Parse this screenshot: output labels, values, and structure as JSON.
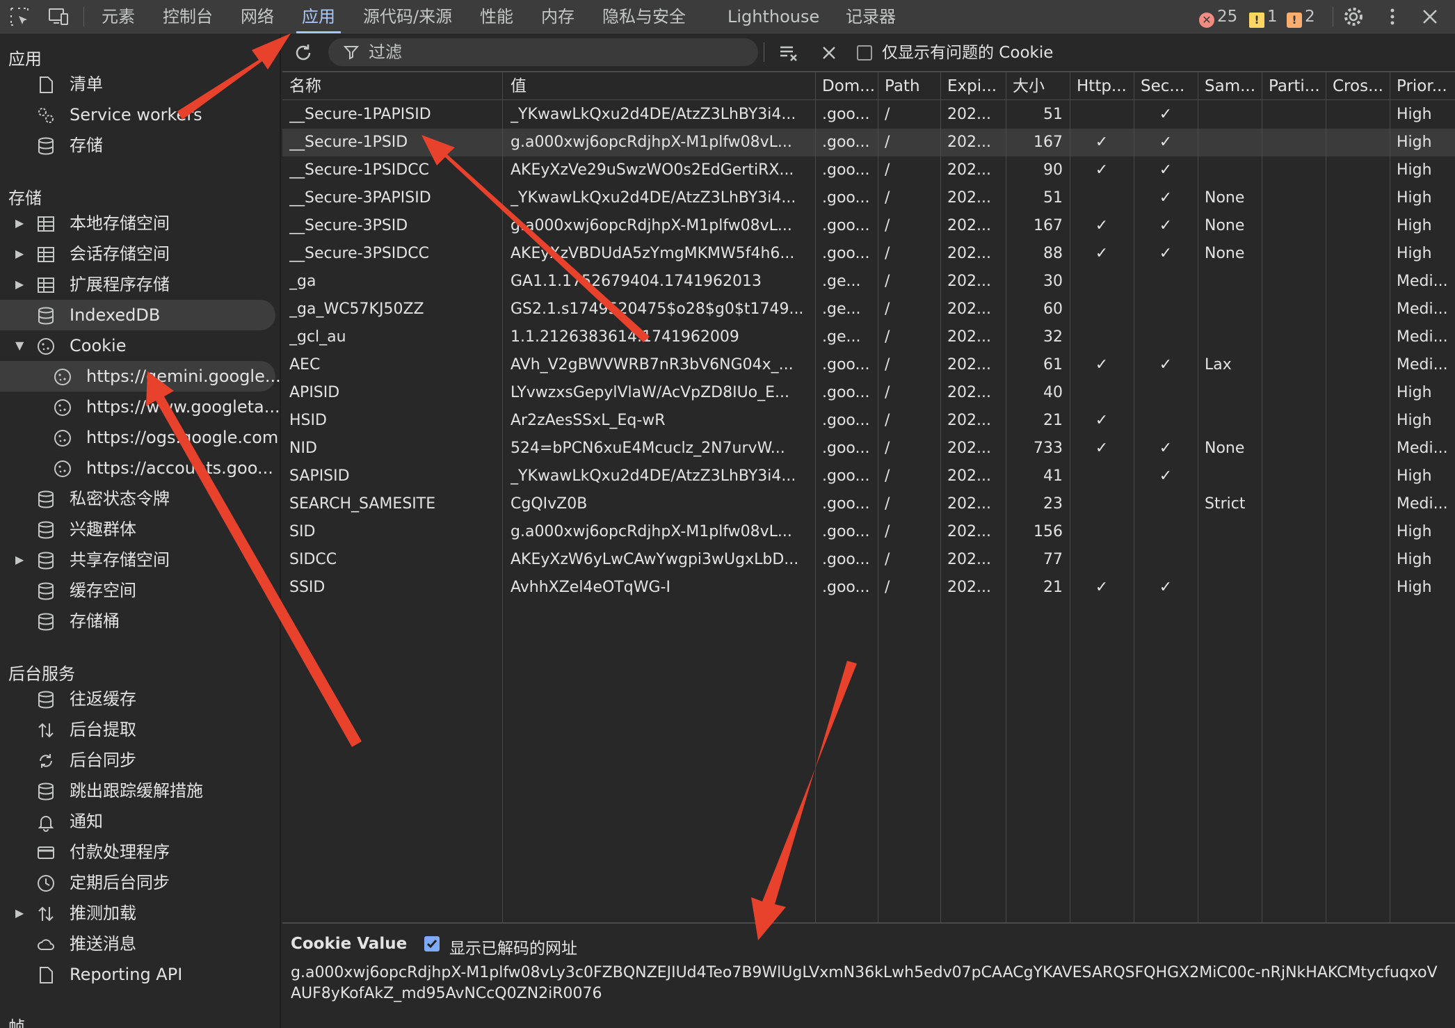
{
  "toolbar": {
    "tabs": [
      "元素",
      "控制台",
      "网络",
      "应用",
      "源代码/来源",
      "性能",
      "内存",
      "隐私与安全",
      "Lighthouse",
      "记录器"
    ],
    "active_tab": "应用",
    "errors": "25",
    "warnings": "1",
    "issues": "2"
  },
  "sidebar": {
    "section_app": "应用",
    "app_items": [
      "清单",
      "Service workers",
      "存储"
    ],
    "section_storage": "存储",
    "storage_items": [
      "本地存储空间",
      "会话存储空间",
      "扩展程序存储",
      "IndexedDB",
      "Cookie"
    ],
    "cookie_origins": [
      "https://gemini.google...",
      "https://www.googleta...",
      "https://ogs.google.com",
      "https://accounts.goo..."
    ],
    "storage_items_2": [
      "私密状态令牌",
      "兴趣群体",
      "共享存储空间",
      "缓存空间",
      "存储桶"
    ],
    "section_bg": "后台服务",
    "bg_items": [
      "往返缓存",
      "后台提取",
      "后台同步",
      "跳出跟踪缓解措施",
      "通知",
      "付款处理程序",
      "定期后台同步",
      "推测加载",
      "推送消息",
      "Reporting API"
    ],
    "section_frames": "帧"
  },
  "filter": {
    "placeholder": "过滤",
    "only_issues_label": "仅显示有问题的 Cookie"
  },
  "table": {
    "headers": [
      "名称",
      "值",
      "Dom...",
      "Path",
      "Expi...",
      "大小",
      "Http...",
      "Sec...",
      "Sam...",
      "Parti...",
      "Cros...",
      "Prior..."
    ],
    "rows": [
      {
        "name": "__Secure-1PAPISID",
        "value": "_YKwawLkQxu2d4DE/AtzZ3LhBY3i4...",
        "domain": ".goo...",
        "path": "/",
        "expires": "202...",
        "size": "51",
        "http": "",
        "secure": "✓",
        "samesite": "",
        "priority": "High"
      },
      {
        "name": "__Secure-1PSID",
        "value": "g.a000xwj6opcRdjhpX-M1plfw08vL...",
        "domain": ".goo...",
        "path": "/",
        "expires": "202...",
        "size": "167",
        "http": "✓",
        "secure": "✓",
        "samesite": "",
        "priority": "High"
      },
      {
        "name": "__Secure-1PSIDCC",
        "value": "AKEyXzVe29uSwzWO0s2EdGertiRX...",
        "domain": ".goo...",
        "path": "/",
        "expires": "202...",
        "size": "90",
        "http": "✓",
        "secure": "✓",
        "samesite": "",
        "priority": "High"
      },
      {
        "name": "__Secure-3PAPISID",
        "value": "_YKwawLkQxu2d4DE/AtzZ3LhBY3i4...",
        "domain": ".goo...",
        "path": "/",
        "expires": "202...",
        "size": "51",
        "http": "",
        "secure": "✓",
        "samesite": "None",
        "priority": "High"
      },
      {
        "name": "__Secure-3PSID",
        "value": "g.a000xwj6opcRdjhpX-M1plfw08vL...",
        "domain": ".goo...",
        "path": "/",
        "expires": "202...",
        "size": "167",
        "http": "✓",
        "secure": "✓",
        "samesite": "None",
        "priority": "High"
      },
      {
        "name": "__Secure-3PSIDCC",
        "value": "AKEyXzVBDUdA5zYmgMKMW5f4h6...",
        "domain": ".goo...",
        "path": "/",
        "expires": "202...",
        "size": "88",
        "http": "✓",
        "secure": "✓",
        "samesite": "None",
        "priority": "High"
      },
      {
        "name": "_ga",
        "value": "GA1.1.1752679404.1741962013",
        "domain": ".ge...",
        "path": "/",
        "expires": "202...",
        "size": "30",
        "http": "",
        "secure": "",
        "samesite": "",
        "priority": "Medi..."
      },
      {
        "name": "_ga_WC57KJ50ZZ",
        "value": "GS2.1.s1749520475$o28$g0$t1749...",
        "domain": ".ge...",
        "path": "/",
        "expires": "202...",
        "size": "60",
        "http": "",
        "secure": "",
        "samesite": "",
        "priority": "Medi..."
      },
      {
        "name": "_gcl_au",
        "value": "1.1.2126383614.1741962009",
        "domain": ".ge...",
        "path": "/",
        "expires": "202...",
        "size": "32",
        "http": "",
        "secure": "",
        "samesite": "",
        "priority": "Medi..."
      },
      {
        "name": "AEC",
        "value": "AVh_V2gBWVWRB7nR3bV6NG04x_...",
        "domain": ".goo...",
        "path": "/",
        "expires": "202...",
        "size": "61",
        "http": "✓",
        "secure": "✓",
        "samesite": "Lax",
        "priority": "Medi..."
      },
      {
        "name": "APISID",
        "value": "LYvwzxsGepylVlaW/AcVpZD8IUo_E...",
        "domain": ".goo...",
        "path": "/",
        "expires": "202...",
        "size": "40",
        "http": "",
        "secure": "",
        "samesite": "",
        "priority": "High"
      },
      {
        "name": "HSID",
        "value": "Ar2zAesSSxL_Eq-wR",
        "domain": ".goo...",
        "path": "/",
        "expires": "202...",
        "size": "21",
        "http": "✓",
        "secure": "",
        "samesite": "",
        "priority": "High"
      },
      {
        "name": "NID",
        "value": "524=bPCN6xuE4Mcuclz_2N7urvW...",
        "domain": ".goo...",
        "path": "/",
        "expires": "202...",
        "size": "733",
        "http": "✓",
        "secure": "✓",
        "samesite": "None",
        "priority": "Medi..."
      },
      {
        "name": "SAPISID",
        "value": "_YKwawLkQxu2d4DE/AtzZ3LhBY3i4...",
        "domain": ".goo...",
        "path": "/",
        "expires": "202...",
        "size": "41",
        "http": "",
        "secure": "✓",
        "samesite": "",
        "priority": "High"
      },
      {
        "name": "SEARCH_SAMESITE",
        "value": "CgQIvZ0B",
        "domain": ".goo...",
        "path": "/",
        "expires": "202...",
        "size": "23",
        "http": "",
        "secure": "",
        "samesite": "Strict",
        "priority": "Medi..."
      },
      {
        "name": "SID",
        "value": "g.a000xwj6opcRdjhpX-M1plfw08vL...",
        "domain": ".goo...",
        "path": "/",
        "expires": "202...",
        "size": "156",
        "http": "",
        "secure": "",
        "samesite": "",
        "priority": "High"
      },
      {
        "name": "SIDCC",
        "value": "AKEyXzW6yLwCAwYwgpi3wUgxLbD...",
        "domain": ".goo...",
        "path": "/",
        "expires": "202...",
        "size": "77",
        "http": "",
        "secure": "",
        "samesite": "",
        "priority": "High"
      },
      {
        "name": "SSID",
        "value": "AvhhXZel4eOTqWG-I",
        "domain": ".goo...",
        "path": "/",
        "expires": "202...",
        "size": "21",
        "http": "✓",
        "secure": "✓",
        "samesite": "",
        "priority": "High"
      }
    ]
  },
  "cookie_value": {
    "title": "Cookie Value",
    "decode_label": "显示已解码的网址",
    "value": "g.a000xwj6opcRdjhpX-M1plfw08vLy3c0FZBQNZEJIUd4Teo7B9WlUgLVxmN36kLwh5edv07pCAACgYKAVESARQSFQHGX2MiC00c-nRjNkHAKCMtycfuqxoVAUF8yKofAkZ_md95AvNCcQ0ZN2iR0076"
  },
  "colors": {
    "accent": "#a8c7fa",
    "error": "#f28b82",
    "warning": "#fdd663",
    "issue": "#fcad70",
    "annotation_arrow": "#e8412c"
  }
}
